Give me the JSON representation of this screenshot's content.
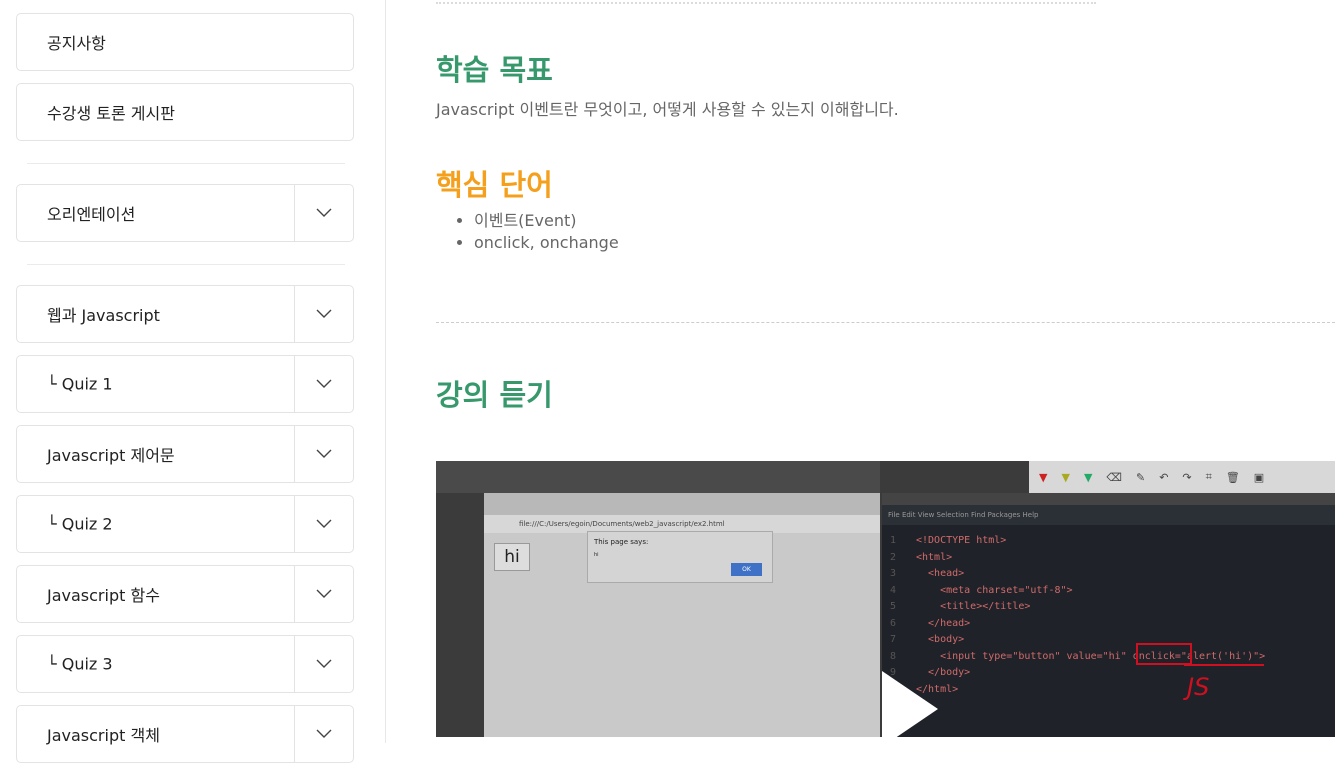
{
  "sidebar": {
    "items": [
      {
        "label": "공지사항",
        "expandable": false
      },
      {
        "label": "수강생 토론 게시판",
        "expandable": false
      },
      {
        "label": "오리엔테이션",
        "expandable": true
      },
      {
        "label": "웹과 Javascript",
        "expandable": true
      },
      {
        "label": "└ Quiz 1",
        "expandable": true
      },
      {
        "label": "Javascript 제어문",
        "expandable": true
      },
      {
        "label": "└ Quiz 2",
        "expandable": true
      },
      {
        "label": "Javascript 함수",
        "expandable": true
      },
      {
        "label": "└ Quiz 3",
        "expandable": true
      },
      {
        "label": "Javascript 객체",
        "expandable": true
      }
    ]
  },
  "main": {
    "goal_title": "학습 목표",
    "goal_desc": "Javascript 이벤트란 무엇이고, 어떻게 사용할 수 있는지 이해합니다.",
    "keywords_title": "핵심 단어",
    "keywords": [
      "이벤트(Event)",
      "onclick, onchange"
    ],
    "lecture_title": "강의 듣기",
    "video": {
      "browser_url": "file:///C:/Users/egoin/Documents/web2_javascript/ex2.html",
      "button_label": "hi",
      "alert_title": "This page says:",
      "alert_message": "hi",
      "alert_ok": "OK",
      "editor_menu": "File  Edit  View  Selection  Find  Packages  Help",
      "code_lines": [
        "<!DOCTYPE html>",
        "<html>",
        "  <head>",
        "    <meta charset=\"utf-8\">",
        "    <title></title>",
        "  </head>",
        "  <body>",
        "    <input type=\"button\" value=\"hi\" onclick=\"alert('hi')\">",
        "  </body>",
        "</html>"
      ],
      "annotation": "JS"
    }
  },
  "colors": {
    "green": "#37996b",
    "orange": "#f5a01d"
  }
}
